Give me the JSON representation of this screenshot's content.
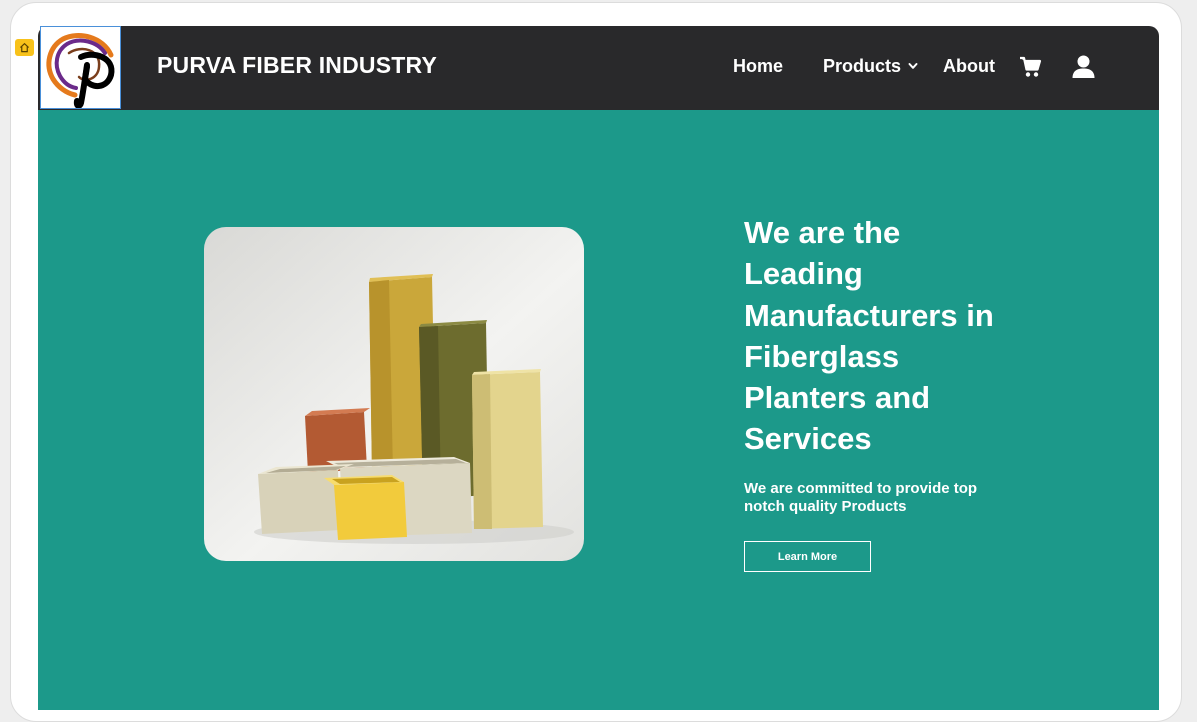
{
  "nav": {
    "brand": "PURVA FIBER INDUSTRY",
    "items": [
      {
        "label": "Home"
      },
      {
        "label": "Products"
      },
      {
        "label": "About"
      }
    ],
    "icons": [
      "cart-icon",
      "user-icon",
      "chevron-down-icon",
      "home-icon"
    ]
  },
  "hero": {
    "headline": "We are the Leading Manufacturers in Fiberglass Planters and Services",
    "subtext": "We are committed to provide top notch quality Products",
    "button_label": "Learn More"
  },
  "colors": {
    "navbar": "#29292b",
    "hero_bg": "#1c998a",
    "text": "#ffffff",
    "badge": "#f8c21a"
  }
}
